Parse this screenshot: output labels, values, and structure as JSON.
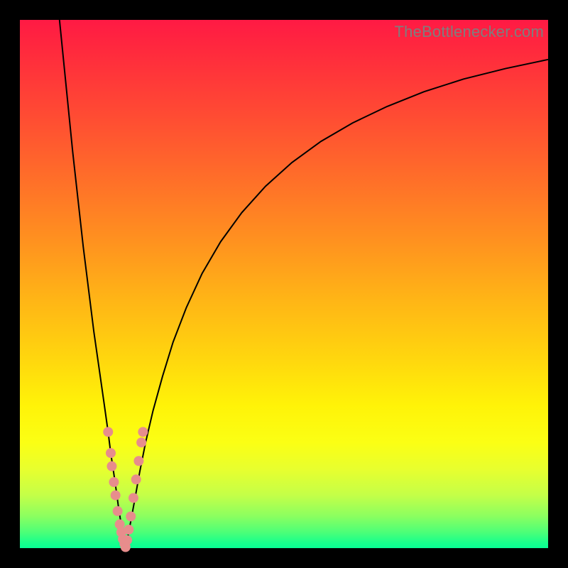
{
  "watermark_text": "TheBottlenecker.com",
  "colors": {
    "frame": "#000000",
    "watermark": "#7e7e7e",
    "curve": "#000000",
    "marker": "#e78d8c",
    "gradient_top": "#ff1a44",
    "gradient_bottom": "#08ff94"
  },
  "chart_data": {
    "type": "line",
    "title": "",
    "xlabel": "",
    "ylabel": "",
    "xlim": [
      0,
      100
    ],
    "ylim": [
      0,
      100
    ],
    "grid": false,
    "legend": false,
    "series": [
      {
        "name": "left-curve",
        "x": [
          7.5,
          8,
          9,
          10,
          11,
          12,
          13,
          14,
          15,
          16,
          16.7,
          17.2,
          17.8,
          18.3,
          18.7,
          19.1,
          19.4,
          19.7,
          19.85,
          20.0
        ],
        "y": [
          100,
          95,
          85,
          75,
          66,
          57,
          49,
          41,
          34,
          27,
          22,
          18,
          14,
          10.5,
          7.5,
          5,
          3.2,
          1.8,
          0.8,
          0.0
        ]
      },
      {
        "name": "right-curve",
        "x": [
          20.0,
          20.3,
          20.7,
          21.2,
          21.9,
          22.7,
          23.8,
          25.2,
          27,
          29,
          31.5,
          34.5,
          38,
          42,
          46.5,
          51.5,
          57,
          63,
          69.5,
          76.5,
          84,
          92,
          100
        ],
        "y": [
          0.0,
          1.5,
          3.5,
          6.2,
          10,
          14.5,
          20,
          26,
          32.5,
          39,
          45.5,
          52,
          58,
          63.5,
          68.5,
          73,
          77,
          80.5,
          83.6,
          86.4,
          88.8,
          90.8,
          92.5
        ]
      }
    ],
    "markers": {
      "name": "highlight-dots",
      "points": [
        {
          "x": 16.7,
          "y": 22.0
        },
        {
          "x": 17.2,
          "y": 18.0
        },
        {
          "x": 17.4,
          "y": 15.5
        },
        {
          "x": 17.8,
          "y": 12.5
        },
        {
          "x": 18.1,
          "y": 10.0
        },
        {
          "x": 18.5,
          "y": 7.0
        },
        {
          "x": 18.9,
          "y": 4.5
        },
        {
          "x": 19.2,
          "y": 3.0
        },
        {
          "x": 19.5,
          "y": 1.7
        },
        {
          "x": 19.8,
          "y": 0.8
        },
        {
          "x": 20.0,
          "y": 0.2
        },
        {
          "x": 20.3,
          "y": 1.5
        },
        {
          "x": 20.6,
          "y": 3.5
        },
        {
          "x": 21.0,
          "y": 6.0
        },
        {
          "x": 21.5,
          "y": 9.5
        },
        {
          "x": 22.0,
          "y": 13.0
        },
        {
          "x": 22.5,
          "y": 16.5
        },
        {
          "x": 23.0,
          "y": 20.0
        },
        {
          "x": 23.3,
          "y": 22.0
        }
      ],
      "radius_px": 7
    }
  }
}
